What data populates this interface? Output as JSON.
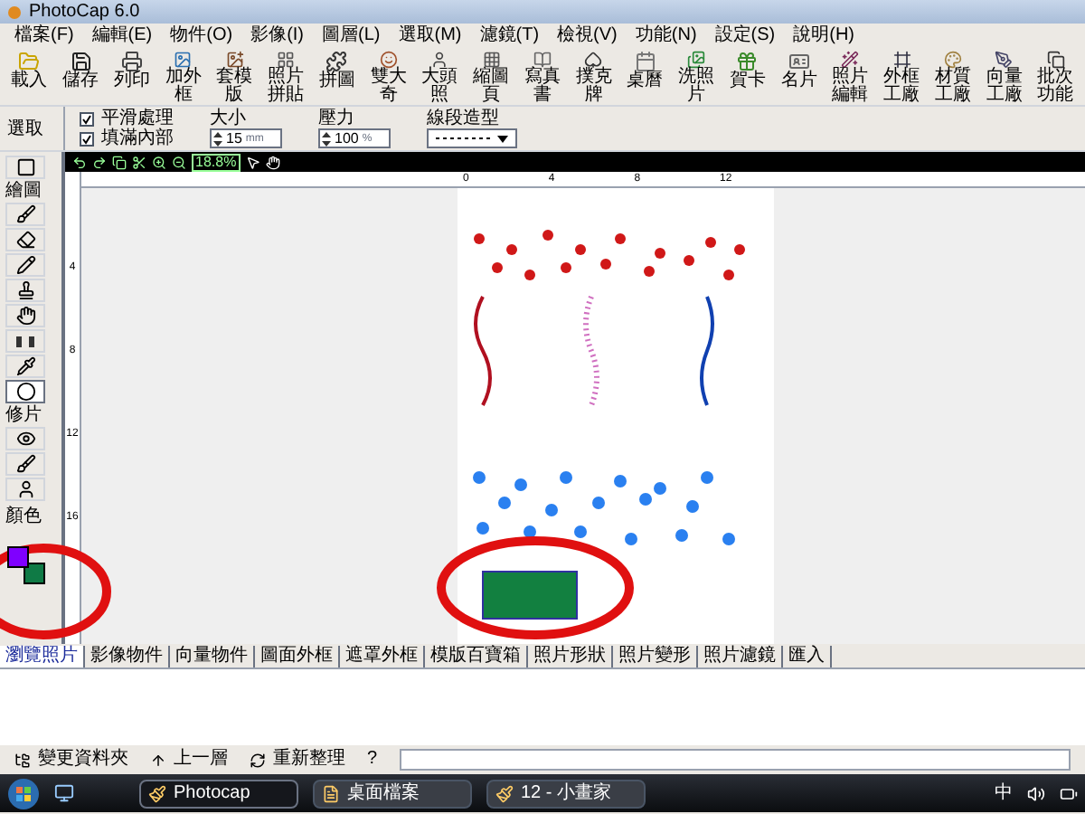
{
  "window": {
    "title": "PhotoCap 6.0"
  },
  "menu": [
    "檔案(F)",
    "編輯(E)",
    "物件(O)",
    "影像(I)",
    "圖層(L)",
    "選取(M)",
    "濾鏡(T)",
    "檢視(V)",
    "功能(N)",
    "設定(S)",
    "說明(H)"
  ],
  "toolbar": [
    "載入",
    "儲存",
    "列印",
    "加外框",
    "套模版",
    "照片拼貼",
    "拼圖",
    "雙大奇",
    "大頭照",
    "縮圖頁",
    "寫真書",
    "撲克牌",
    "桌曆",
    "洗照片",
    "賀卡",
    "名片",
    "照片編輯",
    "外框工廠",
    "材質工廠",
    "向量工廠",
    "批次功能"
  ],
  "properties": {
    "smooth": {
      "label": "平滑處理",
      "checked": true
    },
    "fill": {
      "label": "填滿內部",
      "checked": true
    },
    "size": {
      "label": "大小",
      "value": "15",
      "unit": "mm"
    },
    "pressure": {
      "label": "壓力",
      "value": "100",
      "unit": "%"
    },
    "line_style": {
      "label": "線段造型"
    }
  },
  "tool_groups": [
    {
      "title": "選取",
      "tools": [
        {
          "kind": "rect",
          "selected": false
        }
      ]
    },
    {
      "title": "繪圖",
      "tools": [
        {
          "kind": "brush",
          "selected": false
        },
        {
          "kind": "eraser",
          "selected": false
        },
        {
          "kind": "pencil",
          "selected": false
        },
        {
          "kind": "stamp",
          "selected": false
        },
        {
          "kind": "hand",
          "selected": false
        },
        {
          "kind": "gap",
          "selected": false
        },
        {
          "kind": "dropper",
          "selected": false
        },
        {
          "kind": "ellipse",
          "selected": true
        }
      ]
    },
    {
      "title": "修片",
      "tools": [
        {
          "kind": "eye",
          "selected": false
        },
        {
          "kind": "brush",
          "selected": false
        },
        {
          "kind": "person",
          "selected": false
        }
      ]
    }
  ],
  "colors": {
    "title": "顏色",
    "swatches": [
      {
        "color": "#7f00ff"
      },
      {
        "color": "#0f7a45"
      }
    ]
  },
  "canvas_toolbar": {
    "zoom": "18.8%"
  },
  "rulers": {
    "horizontal": [
      "0",
      "4",
      "8",
      "12"
    ],
    "vertical": [
      "4",
      "8",
      "12",
      "16"
    ]
  },
  "tabs": [
    {
      "label": "瀏覽照片",
      "selected": true
    },
    {
      "label": "影像物件",
      "selected": false
    },
    {
      "label": "向量物件",
      "selected": false
    },
    {
      "label": "圖面外框",
      "selected": false
    },
    {
      "label": "遮罩外框",
      "selected": false
    },
    {
      "label": "模版百寶箱",
      "selected": false
    },
    {
      "label": "照片形狀",
      "selected": false
    },
    {
      "label": "照片變形",
      "selected": false
    },
    {
      "label": "照片濾鏡",
      "selected": false
    },
    {
      "label": "匯入",
      "selected": false
    }
  ],
  "bottom_bar": [
    "變更資料夾",
    "上一層",
    "重新整理",
    "?"
  ],
  "taskbar": {
    "items": [
      {
        "label": "Photocap",
        "selected": true
      },
      {
        "label": "桌面檔案",
        "selected": false
      },
      {
        "label": "12 - 小畫家",
        "selected": false
      }
    ],
    "ime": "中"
  }
}
